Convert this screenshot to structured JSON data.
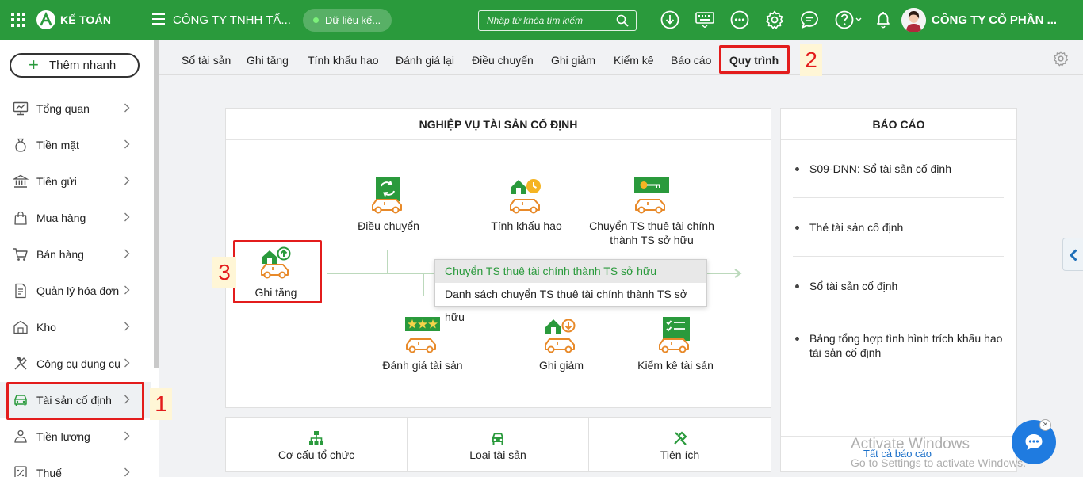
{
  "topbar": {
    "app_name": "KẾ TOÁN",
    "company": "CÔNG TY TNHH TẤ...",
    "data_pill": "Dữ liệu kế...",
    "search_placeholder": "Nhập từ khóa tìm kiếm",
    "user_company": "CÔNG TY CỔ PHẦN ...",
    "brand_color": "#2a9a3c"
  },
  "sidebar": {
    "quick_add": "Thêm nhanh",
    "items": [
      {
        "label": "Tổng quan",
        "icon": "monitor-icon"
      },
      {
        "label": "Tiền mặt",
        "icon": "money-bag-icon"
      },
      {
        "label": "Tiền gửi",
        "icon": "bank-icon"
      },
      {
        "label": "Mua hàng",
        "icon": "shopping-bag-icon"
      },
      {
        "label": "Bán hàng",
        "icon": "cart-icon"
      },
      {
        "label": "Quản lý hóa đơn",
        "icon": "invoice-icon"
      },
      {
        "label": "Kho",
        "icon": "warehouse-icon"
      },
      {
        "label": "Công cụ dụng cụ",
        "icon": "tools-icon"
      },
      {
        "label": "Tài sản cố định",
        "icon": "car-icon"
      },
      {
        "label": "Tiền lương",
        "icon": "payroll-icon"
      },
      {
        "label": "Thuế",
        "icon": "tax-icon"
      }
    ]
  },
  "tabs": [
    "Sổ tài sản",
    "Ghi tăng",
    "Tính khấu hao",
    "Đánh giá lại",
    "Điều chuyển",
    "Ghi giảm",
    "Kiểm kê",
    "Báo cáo",
    "Quy trình"
  ],
  "active_tab": "Quy trình",
  "annotations": {
    "step1": "1",
    "step2": "2",
    "step3": "3",
    "color": "#e31c1c"
  },
  "process": {
    "title": "NGHIỆP VỤ TÀI SẢN CỐ ĐỊNH",
    "nodes": {
      "ghi_tang": "Ghi tăng",
      "dieu_chuyen": "Điều chuyển",
      "tinh_khau_hao": "Tính khấu hao",
      "chuyen_ts": "Chuyển TS thuê tài chính thành TS sở hữu",
      "danh_gia": "Đánh giá tài sản",
      "ghi_giam": "Ghi giảm",
      "kiem_ke": "Kiểm kê tài sản"
    },
    "dropdown": [
      "Chuyển TS thuê tài chính thành TS sở hữu",
      "Danh sách chuyển TS thuê tài chính thành TS sở hữu"
    ]
  },
  "reports": {
    "title": "BÁO CÁO",
    "items": [
      "S09-DNN: Sổ tài sản cố định",
      "Thẻ tài sản cố định",
      "Sổ tài sản cố định",
      "Bảng tổng hợp tình hình trích khấu hao tài sản cố định"
    ],
    "all_link": "Tất cả báo cáo"
  },
  "bottom": [
    "Cơ cấu tổ chức",
    "Loại tài sản",
    "Tiện ích"
  ],
  "watermark": {
    "line1": "Activate Windows",
    "line2": "Go to Settings to activate Windows."
  }
}
